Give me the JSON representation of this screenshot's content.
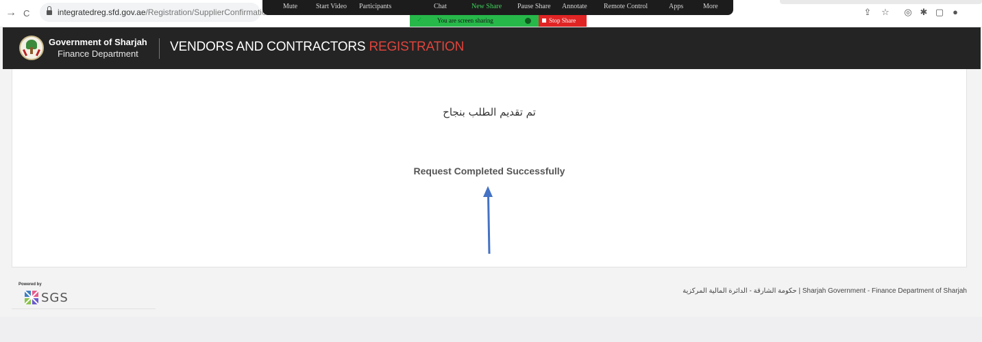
{
  "browser": {
    "back_glyph": "→",
    "reload_glyph": "C",
    "url_host": "integratedreg.sfd.gov.ae",
    "url_path": "/Registration/SupplierConfirmation",
    "icons": [
      "share-icon",
      "star-icon",
      "camera-icon",
      "extensions-icon",
      "sidepanel-icon",
      "profile-icon"
    ]
  },
  "zoom_toolbar": {
    "items": [
      "Mute",
      "Start Video",
      "Participants",
      "Chat",
      "New Share",
      "Pause Share",
      "Annotate",
      "Remote Control",
      "Apps",
      "More"
    ],
    "sharing_text": "You are screen sharing",
    "stop_label": "Stop Share",
    "active_color": "#3ed25a",
    "stop_color": "#e02424"
  },
  "header": {
    "gov_title": "Government of Sharjah",
    "gov_subtitle": "Finance Department",
    "title_main": "VENDORS AND CONTRACTORS ",
    "title_accent": "REGISTRATION",
    "accent_color": "#e0443c",
    "background": "#242424"
  },
  "content": {
    "arabic_message": "تم تقديم الطلب بنجاح",
    "success_message": "Request Completed Successfully",
    "annotation_arrow_color": "#4472c4"
  },
  "footer": {
    "powered_by": "Powered by",
    "brand": "SGS",
    "copyright": "حكومة الشارقة - الدائرة المالية المركزية | Sharjah Government - Finance Department of Sharjah"
  }
}
